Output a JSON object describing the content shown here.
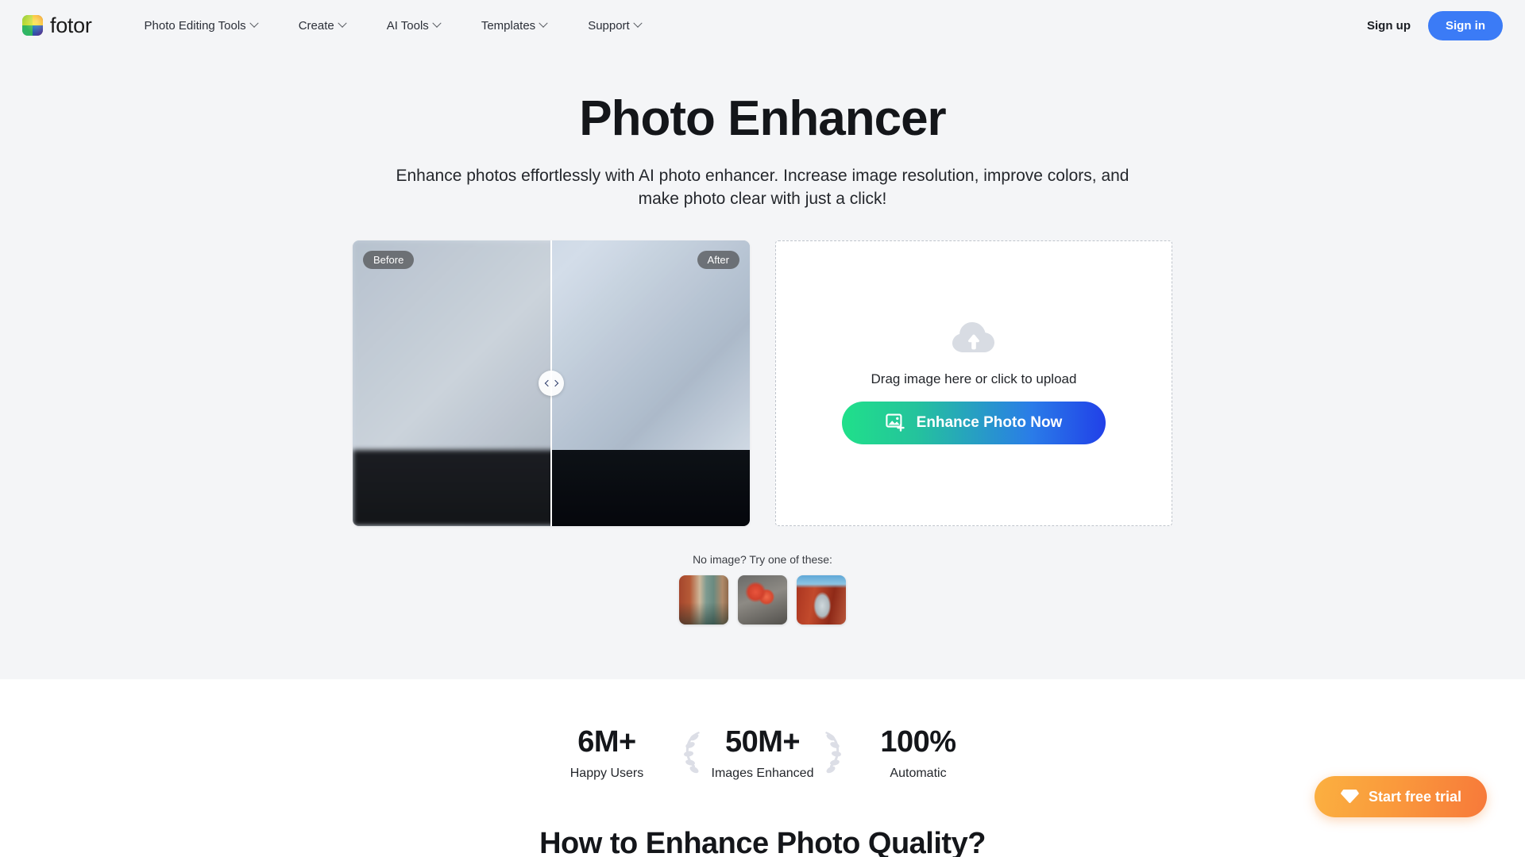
{
  "header": {
    "brand_name": "fotor",
    "logo_icon": "fotor-logo-icon",
    "nav": [
      {
        "label": "Photo Editing Tools",
        "icon": "chevron-down-icon"
      },
      {
        "label": "Create",
        "icon": "chevron-down-icon"
      },
      {
        "label": "AI Tools",
        "icon": "chevron-down-icon"
      },
      {
        "label": "Templates",
        "icon": "chevron-down-icon"
      },
      {
        "label": "Support",
        "icon": "chevron-down-icon"
      }
    ],
    "sign_up_label": "Sign up",
    "sign_in_label": "Sign in",
    "sign_in_color": "#3b7bf6"
  },
  "hero": {
    "title": "Photo Enhancer",
    "subtitle": "Enhance photos effortlessly with AI photo enhancer. Increase image resolution, improve colors, and make photo clear with just a click!",
    "background_color": "#f4f5f7"
  },
  "compare": {
    "before_label": "Before",
    "after_label": "After",
    "handle_icon": "left-right-chevron-handle-icon",
    "divider_position_percent": 50
  },
  "dropzone": {
    "upload_icon": "cloud-upload-icon",
    "prompt": "Drag image here or click to upload",
    "button_label": "Enhance Photo Now",
    "button_icon": "image-plus-icon",
    "button_gradient_from": "#20e08a",
    "button_gradient_to": "#2140e8"
  },
  "samples": {
    "label": "No image? Try one of these:",
    "thumbs": [
      {
        "name": "sample-venice-canal"
      },
      {
        "name": "sample-red-roses"
      },
      {
        "name": "sample-red-archway"
      }
    ]
  },
  "stats": {
    "items": [
      {
        "value": "6M+",
        "label": "Happy Users",
        "laurel": false
      },
      {
        "value": "50M+",
        "label": "Images Enhanced",
        "laurel": true
      },
      {
        "value": "100%",
        "label": "Automatic",
        "laurel": false
      }
    ]
  },
  "bottom_section": {
    "heading": "How to Enhance Photo Quality?"
  },
  "free_trial": {
    "label": "Start free trial",
    "icon": "diamond-gem-icon",
    "gradient_from": "#fbb040",
    "gradient_to": "#f7793a"
  }
}
